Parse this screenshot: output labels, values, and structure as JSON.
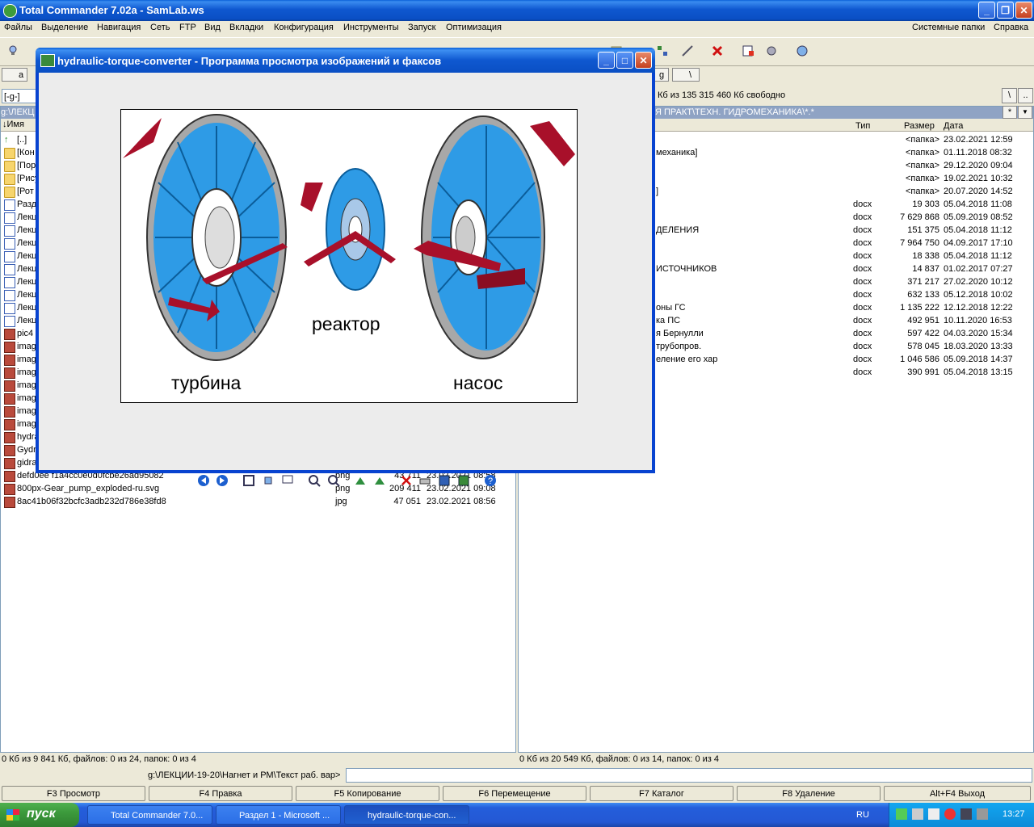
{
  "tc": {
    "title": "Total Commander 7.02a - SamLab.ws",
    "menu": [
      "Файлы",
      "Выделение",
      "Навигация",
      "Сеть",
      "FTP",
      "Вид",
      "Вкладки",
      "Конфигурация",
      "Инструменты",
      "Запуск",
      "Оптимизация"
    ],
    "menu_right": [
      "Системные папки",
      "Справка"
    ]
  },
  "left": {
    "drive_label": "a",
    "drive_combo": "[-g-]",
    "path": "g:\\ЛЕКЦ",
    "col_name": "↓Имя",
    "items": [
      {
        "icon": "up-arrow",
        "name": "[..]",
        "ext": "",
        "size": "",
        "date": ""
      },
      {
        "icon": "folder",
        "name": "[Кон",
        "ext": "",
        "size": "",
        "date": ""
      },
      {
        "icon": "folder",
        "name": "[Пор",
        "ext": "",
        "size": "",
        "date": ""
      },
      {
        "icon": "folder",
        "name": "[Рису",
        "ext": "",
        "size": "",
        "date": ""
      },
      {
        "icon": "folder",
        "name": "[Рот",
        "ext": "",
        "size": "",
        "date": ""
      },
      {
        "icon": "doc",
        "name": "Разд",
        "ext": "",
        "size": "",
        "date": ""
      },
      {
        "icon": "doc",
        "name": "Лекц",
        "ext": "",
        "size": "",
        "date": ""
      },
      {
        "icon": "doc",
        "name": "Лекц",
        "ext": "",
        "size": "",
        "date": ""
      },
      {
        "icon": "doc",
        "name": "Лекц",
        "ext": "",
        "size": "",
        "date": ""
      },
      {
        "icon": "doc",
        "name": "Лекц",
        "ext": "",
        "size": "",
        "date": ""
      },
      {
        "icon": "doc",
        "name": "Лекц",
        "ext": "",
        "size": "",
        "date": ""
      },
      {
        "icon": "doc",
        "name": "Лекц",
        "ext": "",
        "size": "",
        "date": ""
      },
      {
        "icon": "doc",
        "name": "Лекц",
        "ext": "",
        "size": "",
        "date": ""
      },
      {
        "icon": "doc",
        "name": "Лекц",
        "ext": "",
        "size": "",
        "date": ""
      },
      {
        "icon": "doc",
        "name": "Лекц",
        "ext": "",
        "size": "",
        "date": ""
      },
      {
        "icon": "img",
        "name": "pic4",
        "ext": "",
        "size": "",
        "date": ""
      },
      {
        "icon": "img",
        "name": "imag",
        "ext": "",
        "size": "",
        "date": ""
      },
      {
        "icon": "img",
        "name": "imag",
        "ext": "",
        "size": "",
        "date": ""
      },
      {
        "icon": "img",
        "name": "imag",
        "ext": "",
        "size": "",
        "date": ""
      },
      {
        "icon": "img",
        "name": "imag",
        "ext": "",
        "size": "",
        "date": ""
      },
      {
        "icon": "img",
        "name": "imag",
        "ext": "",
        "size": "",
        "date": ""
      },
      {
        "icon": "img",
        "name": "imag",
        "ext": "",
        "size": "",
        "date": ""
      },
      {
        "icon": "img",
        "name": "imag",
        "ext": "",
        "size": "",
        "date": ""
      },
      {
        "icon": "img",
        "name": "hydra",
        "ext": "",
        "size": "",
        "date": ""
      },
      {
        "icon": "img",
        "name": "Gydr",
        "ext": "",
        "size": "",
        "date": ""
      },
      {
        "icon": "img",
        "name": "gidra",
        "ext": "",
        "size": "",
        "date": ""
      },
      {
        "icon": "img",
        "name": "defd0ee f1a4cc0e0d0fcbe26ad95082",
        "ext": "png",
        "size": "43 711",
        "date": "23.02.2021 08:58"
      },
      {
        "icon": "img",
        "name": "800px-Gear_pump_exploded-ru.svg",
        "ext": "png",
        "size": "209 411",
        "date": "23.02.2021 09:08"
      },
      {
        "icon": "img",
        "name": "8ac41b06f32bcfc3adb232d786e38fd8",
        "ext": "jpg",
        "size": "47 051",
        "date": "23.02.2021 08:56"
      }
    ],
    "status": "0 Кб из 9 841 Кб, файлов: 0 из 24, папок: 0 из 4"
  },
  "right": {
    "drive_label": "g",
    "drive_root": "\\",
    "free": "Кб из 135 315 460 Кб свободно",
    "path": "Я ПРАКТ\\ТЕХН. ГИДРОМЕХАНИКА\\*.*",
    "cols": {
      "type": "Тип",
      "size": "Размер",
      "date": "Дата"
    },
    "items": [
      {
        "name": "",
        "ext": "",
        "size": "<папка>",
        "date": "23.02.2021 12:59"
      },
      {
        "name": "механика]",
        "ext": "",
        "size": "<папка>",
        "date": "01.11.2018 08:32"
      },
      {
        "name": "",
        "ext": "",
        "size": "<папка>",
        "date": "29.12.2020 09:04"
      },
      {
        "name": "",
        "ext": "",
        "size": "<папка>",
        "date": "19.02.2021 10:32"
      },
      {
        "name": "]",
        "ext": "",
        "size": "<папка>",
        "date": "20.07.2020 14:52"
      },
      {
        "name": "",
        "ext": "docx",
        "size": "19 303",
        "date": "05.04.2018 11:08"
      },
      {
        "name": "",
        "ext": "docx",
        "size": "7 629 868",
        "date": "05.09.2019 08:52"
      },
      {
        "name": "ДЕЛЕНИЯ",
        "ext": "docx",
        "size": "151 375",
        "date": "05.04.2018 11:12"
      },
      {
        "name": "",
        "ext": "docx",
        "size": "7 964 750",
        "date": "04.09.2017 17:10"
      },
      {
        "name": "",
        "ext": "docx",
        "size": "18 338",
        "date": "05.04.2018 11:12"
      },
      {
        "name": "ИСТОЧНИКОВ",
        "ext": "docx",
        "size": "14 837",
        "date": "01.02.2017 07:27"
      },
      {
        "name": "",
        "ext": "docx",
        "size": "371 217",
        "date": "27.02.2020 10:12"
      },
      {
        "name": "",
        "ext": "docx",
        "size": "632 133",
        "date": "05.12.2018 10:02"
      },
      {
        "name": "оны ГС",
        "ext": "docx",
        "size": "1 135 222",
        "date": "12.12.2018 12:22"
      },
      {
        "name": "ка ПС",
        "ext": "docx",
        "size": "492 951",
        "date": "10.11.2020 16:53"
      },
      {
        "name": "я Бернулли",
        "ext": "docx",
        "size": "597 422",
        "date": "04.03.2020 15:34"
      },
      {
        "name": "трубопров.",
        "ext": "docx",
        "size": "578 045",
        "date": "18.03.2020 13:33"
      },
      {
        "name": "еление его хар",
        "ext": "docx",
        "size": "1 046 586",
        "date": "05.09.2018 14:37"
      },
      {
        "name": "",
        "ext": "docx",
        "size": "390 991",
        "date": "05.04.2018 13:15"
      }
    ],
    "status": "0 Кб из 20 549 Кб, файлов: 0 из 14, папок: 0 из 4"
  },
  "cmdline": {
    "prompt": "g:\\ЛЕКЦИИ-19-20\\Нагнет и РМ\\Текст раб. вар>",
    "value": ""
  },
  "fkeys": [
    "F3 Просмотр",
    "F4 Правка",
    "F5 Копирование",
    "F6 Перемещение",
    "F7 Каталог",
    "F8 Удаление",
    "Alt+F4 Выход"
  ],
  "viewer": {
    "title": "hydraulic-torque-converter - Программа просмотра изображений и факсов",
    "labels": {
      "turbine": "турбина",
      "reactor": "реактор",
      "pump": "насос"
    }
  },
  "taskbar": {
    "start": "пуск",
    "tasks": [
      "Total Commander 7.0...",
      "Раздел 1 - Microsoft ...",
      "hydraulic-torque-con..."
    ],
    "lang": "RU",
    "clock": "13:27"
  }
}
